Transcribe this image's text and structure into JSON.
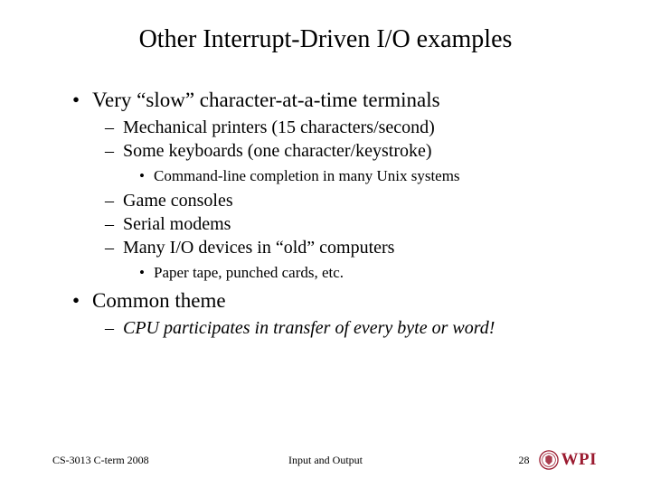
{
  "title": "Other Interrupt-Driven I/O examples",
  "bullets": {
    "b1": "Very “slow” character-at-a-time terminals",
    "b1_1": "Mechanical printers (15 characters/second)",
    "b1_2": "Some keyboards (one character/keystroke)",
    "b1_2_1": "Command-line completion in many Unix systems",
    "b1_3": "Game consoles",
    "b1_4": "Serial modems",
    "b1_5": "Many I/O devices in “old” computers",
    "b1_5_1": "Paper tape, punched cards, etc.",
    "b2": "Common theme",
    "b2_1": "CPU participates in transfer of every byte or word!"
  },
  "footer": {
    "left": "CS-3013 C-term 2008",
    "center": "Input and Output",
    "page": "28",
    "logo_text": "WPI"
  },
  "colors": {
    "wpi_crimson": "#9b1b30"
  }
}
